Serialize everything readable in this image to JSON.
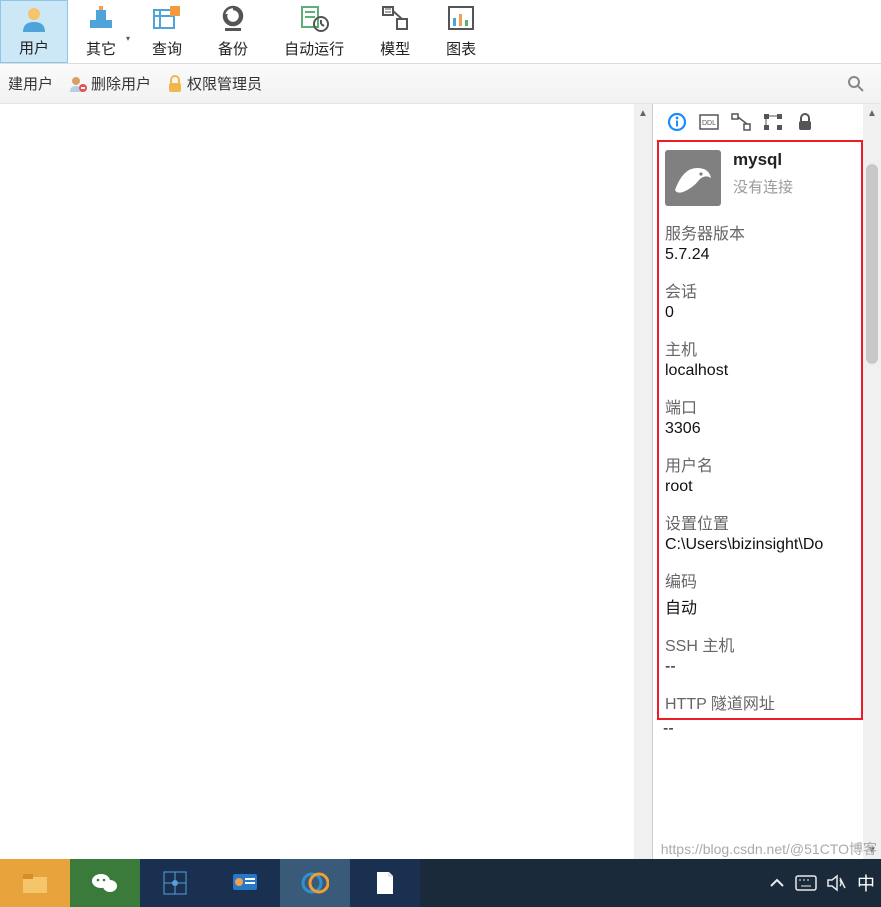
{
  "ribbon": {
    "user": "用户",
    "other": "其它",
    "query": "查询",
    "backup": "备份",
    "autorun": "自动运行",
    "model": "模型",
    "chart": "图表"
  },
  "toolbar": {
    "create_user": "建用户",
    "delete_user": "删除用户",
    "privilege_admin": "权限管理员"
  },
  "side": {
    "conn_name": "mysql",
    "conn_status": "没有连接",
    "props": {
      "server_version_label": "服务器版本",
      "server_version_value": "5.7.24",
      "session_label": "会话",
      "session_value": "0",
      "host_label": "主机",
      "host_value": "localhost",
      "port_label": "端口",
      "port_value": "3306",
      "username_label": "用户名",
      "username_value": "root",
      "settings_path_label": "设置位置",
      "settings_path_value": "C:\\Users\\bizinsight\\Do",
      "encoding_label": "编码",
      "encoding_value": "自动",
      "ssh_host_label": "SSH 主机",
      "ssh_host_value": "--",
      "http_tunnel_label": "HTTP 隧道网址",
      "http_tunnel_value": "--"
    }
  },
  "watermark": "https://blog.csdn.net/@51CTO博客",
  "tray_ime": "中"
}
